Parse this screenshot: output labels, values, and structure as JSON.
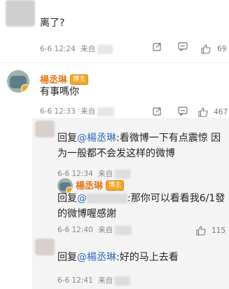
{
  "comments": [
    {
      "text": "离了?",
      "date": "6-6 12:24",
      "source_prefix": "来自",
      "likes": "69"
    },
    {
      "author": "楊丞琳",
      "badge": "博主",
      "text": "有事嗎你",
      "date": "6-6 12:33",
      "source_prefix": "来自",
      "likes": "467",
      "replies": [
        {
          "text_prefix": "回复",
          "mention": "@楊丞琳",
          "text_body": ":看微博一下有点震惊 因为一般都不会发这样的微博",
          "date": "6-6 12:34",
          "source_prefix": "来自"
        },
        {
          "author": "楊丞琳",
          "badge": "博主",
          "text_prefix": "回复",
          "mention": "@",
          "text_body": ":那你可以看看我6/1發的微博喔感謝",
          "date": "6-6 12:40",
          "source_prefix": "来自",
          "likes": "115"
        },
        {
          "text_prefix": "回复",
          "mention": "@楊丞琳",
          "text_body": ":好的马上去看",
          "date": "6-6 12:41",
          "source_prefix": "来自"
        }
      ]
    }
  ],
  "icons": {
    "share": "share-icon",
    "comment": "comment-icon",
    "like": "thumbs-up-icon"
  }
}
